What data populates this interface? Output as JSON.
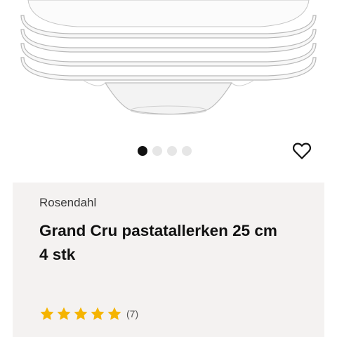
{
  "product": {
    "brand": "Rosendahl",
    "title": "Grand Cru pastatallerken 25 cm 4 stk",
    "rating_stars": 5,
    "review_count": "(7)"
  },
  "gallery": {
    "image_count": 4,
    "active_index": 0,
    "image_subject": "plate-stack-icon"
  },
  "icons": {
    "wishlist": "heart-outline-icon",
    "star": "star-icon"
  },
  "colors": {
    "star": "#f5b400",
    "card_background": "#f4f2f1",
    "active_dot": "#111111",
    "inactive_dot": "#e6e6e6"
  }
}
